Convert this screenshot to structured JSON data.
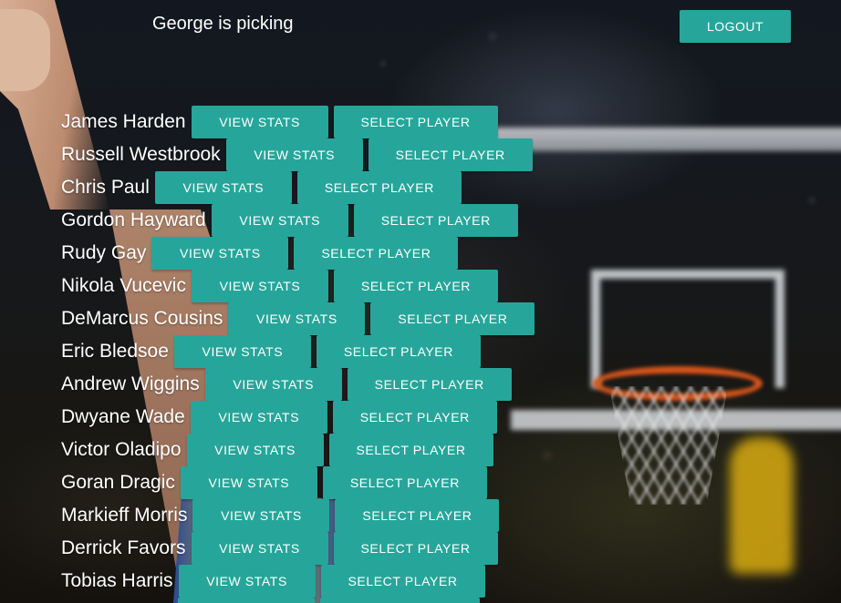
{
  "header": {
    "picking_text": "George is picking",
    "logout_label": "LOGOUT"
  },
  "colors": {
    "accent": "#26a69a",
    "text": "#ffffff"
  },
  "players": [
    {
      "name": "James Harden",
      "stats_label": "VIEW STATS",
      "select_label": "SELECT PLAYER"
    },
    {
      "name": "Russell Westbrook",
      "stats_label": "VIEW STATS",
      "select_label": "SELECT PLAYER"
    },
    {
      "name": "Chris Paul",
      "stats_label": "VIEW STATS",
      "select_label": "SELECT PLAYER"
    },
    {
      "name": "Gordon Hayward",
      "stats_label": "VIEW STATS",
      "select_label": "SELECT PLAYER"
    },
    {
      "name": "Rudy Gay",
      "stats_label": "VIEW STATS",
      "select_label": "SELECT PLAYER"
    },
    {
      "name": "Nikola Vucevic",
      "stats_label": "VIEW STATS",
      "select_label": "SELECT PLAYER"
    },
    {
      "name": "DeMarcus Cousins",
      "stats_label": "VIEW STATS",
      "select_label": "SELECT PLAYER"
    },
    {
      "name": "Eric Bledsoe",
      "stats_label": "VIEW STATS",
      "select_label": "SELECT PLAYER"
    },
    {
      "name": "Andrew Wiggins",
      "stats_label": "VIEW STATS",
      "select_label": "SELECT PLAYER"
    },
    {
      "name": "Dwyane Wade",
      "stats_label": "VIEW STATS",
      "select_label": "SELECT PLAYER"
    },
    {
      "name": "Victor Oladipo",
      "stats_label": "VIEW STATS",
      "select_label": "SELECT PLAYER"
    },
    {
      "name": "Goran Dragic",
      "stats_label": "VIEW STATS",
      "select_label": "SELECT PLAYER"
    },
    {
      "name": "Markieff Morris",
      "stats_label": "VIEW STATS",
      "select_label": "SELECT PLAYER"
    },
    {
      "name": "Derrick Favors",
      "stats_label": "VIEW STATS",
      "select_label": "SELECT PLAYER"
    },
    {
      "name": "Tobias Harris",
      "stats_label": "VIEW STATS",
      "select_label": "SELECT PLAYER"
    }
  ]
}
